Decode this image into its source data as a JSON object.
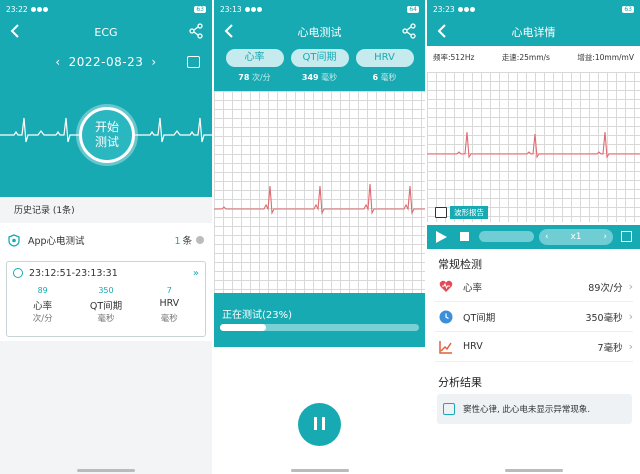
{
  "screens": [
    {
      "status": {
        "time": "23:22",
        "battery": "63"
      },
      "title": "ECG",
      "date": "2022-08-23",
      "start_button": [
        "开始",
        "测试"
      ],
      "history_label": "历史记录 (1条)",
      "app_item": {
        "label": "App心电测试",
        "count": "1",
        "count_unit": "条"
      },
      "record": {
        "time_range": "23:12:51-23:13:31",
        "metrics": [
          {
            "value": "89",
            "name": "心率",
            "unit": "次/分"
          },
          {
            "value": "350",
            "name": "QT间期",
            "unit": "毫秒"
          },
          {
            "value": "7",
            "name": "HRV",
            "unit": "毫秒"
          }
        ]
      }
    },
    {
      "status": {
        "time": "23:13",
        "battery": "64"
      },
      "title": "心电测试",
      "tabs": [
        "心率",
        "QT间期",
        "HRV"
      ],
      "tab_values": [
        {
          "value": "78",
          "unit": "次/分"
        },
        {
          "value": "349",
          "unit": "毫秒"
        },
        {
          "value": "6",
          "unit": "毫秒"
        }
      ],
      "progress_label": "正在测试(23%)",
      "progress": 0.23
    },
    {
      "status": {
        "time": "23:23",
        "battery": "63"
      },
      "title": "心电详情",
      "params": [
        "频率:512Hz",
        "走速:25mm/s",
        "增益:10mm/mV"
      ],
      "report_label": "波形报告",
      "speed_label": "x1",
      "routine_title": "常规检测",
      "routine_items": [
        {
          "name": "心率",
          "value": "89次/分"
        },
        {
          "name": "QT间期",
          "value": "350毫秒"
        },
        {
          "name": "HRV",
          "value": "7毫秒"
        }
      ],
      "analysis_title": "分析结果",
      "analysis_text": "窦性心律, 此心电未显示异常现象."
    }
  ],
  "colors": {
    "accent": "#18aab3",
    "ecg_line": "#e06a70",
    "heart": "#e24a55",
    "clock": "#3d8fd9",
    "hrv": "#e0603a"
  },
  "icons": [
    "back-arrow-icon",
    "share-icon",
    "calendar-icon",
    "shield-icon",
    "clock-icon",
    "fast-forward-icon",
    "pause-icon",
    "play-icon",
    "stop-icon",
    "fullscreen-icon",
    "heart-icon",
    "hrv-icon",
    "report-icon"
  ]
}
